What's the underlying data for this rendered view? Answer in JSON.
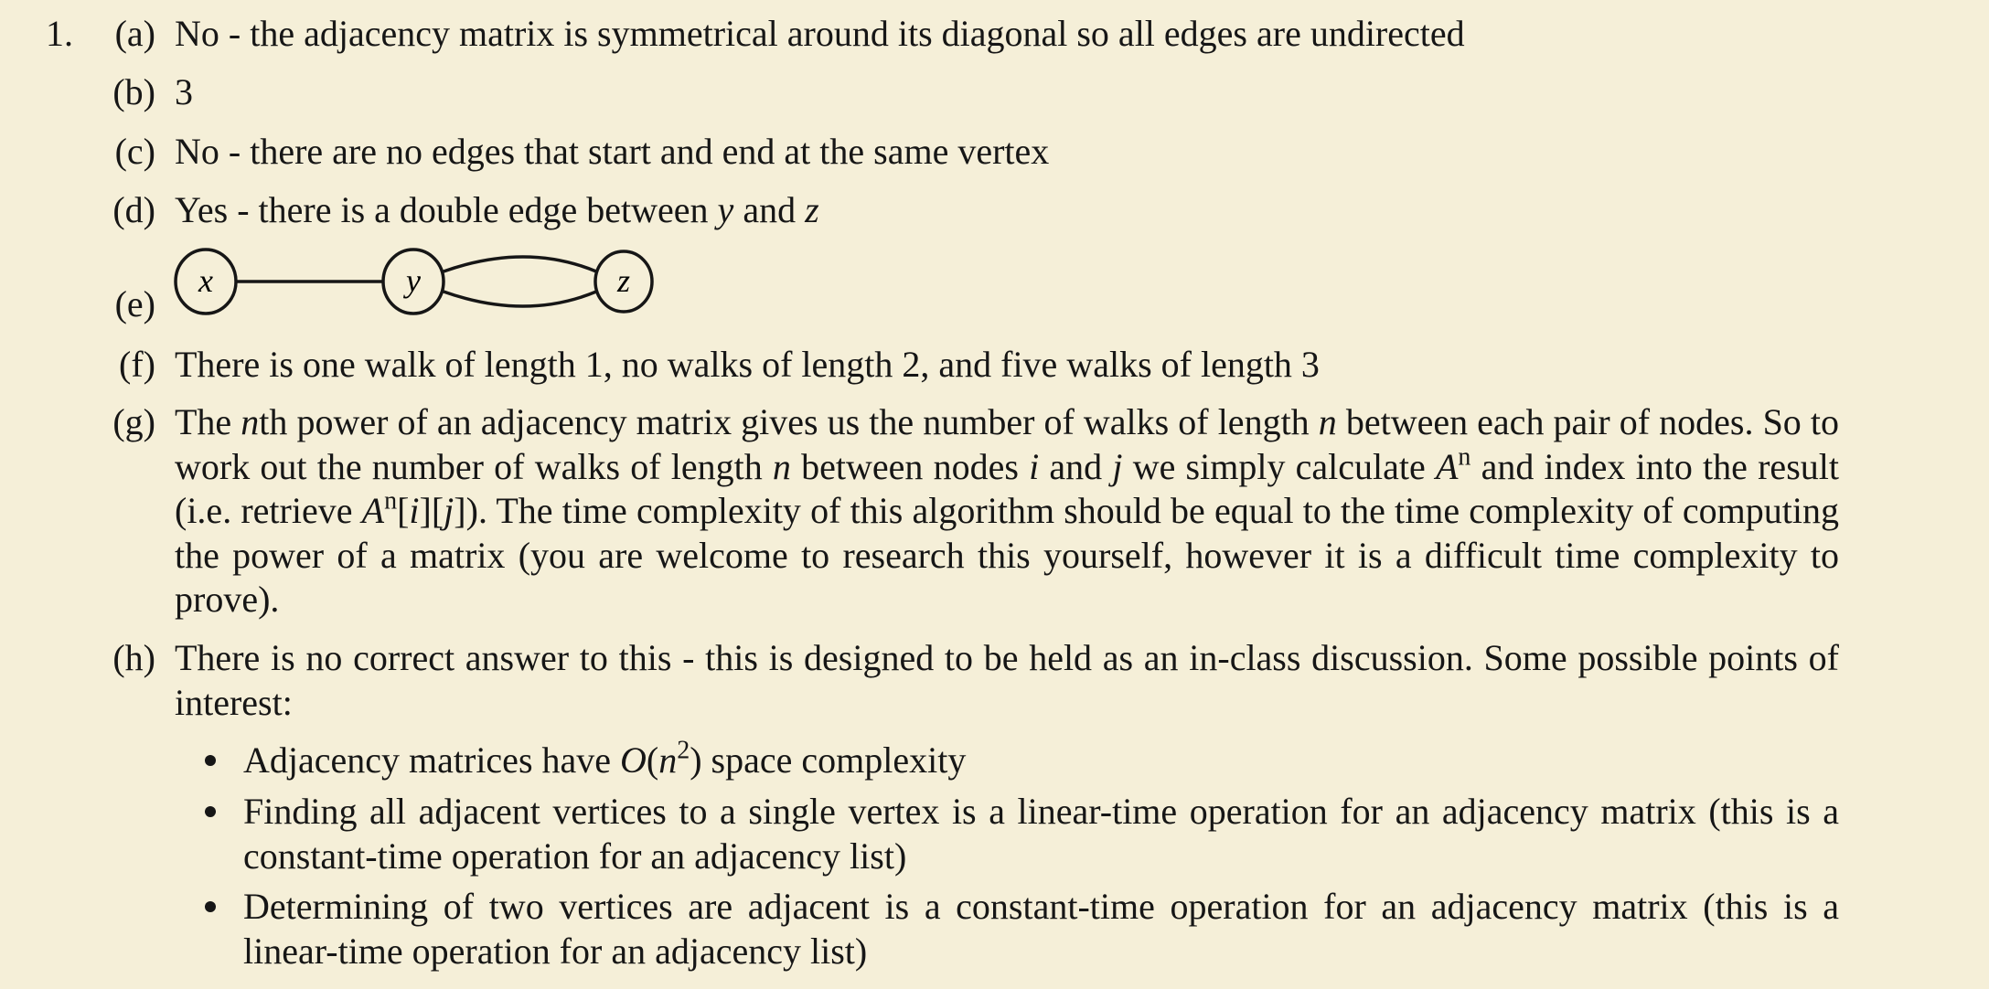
{
  "question_number": "1.",
  "items": [
    {
      "label": "(a)",
      "parts": [
        {
          "t": "No - the adjacency matrix is symmetrical around its diagonal so all edges are undirected"
        }
      ]
    },
    {
      "label": "(b)",
      "parts": [
        {
          "t": "3"
        }
      ]
    },
    {
      "label": "(c)",
      "parts": [
        {
          "t": "No - there are no edges that start and end at the same vertex"
        }
      ]
    },
    {
      "label": "(d)",
      "parts": [
        {
          "t": "Yes - there is a double edge between "
        },
        {
          "t": "y",
          "m": "i"
        },
        {
          "t": " and "
        },
        {
          "t": "z",
          "m": "i"
        }
      ]
    },
    {
      "label": "(e)",
      "graph": {
        "nodes": [
          "x",
          "y",
          "z"
        ],
        "edges": [
          [
            "x",
            "y"
          ],
          [
            "y",
            "z"
          ],
          [
            "y",
            "z"
          ]
        ]
      }
    },
    {
      "label": "(f)",
      "parts": [
        {
          "t": "There is one walk of length 1, no walks of length 2, and five walks of length 3"
        }
      ]
    },
    {
      "label": "(g)",
      "parts": [
        {
          "t": "The "
        },
        {
          "t": "n",
          "m": "i"
        },
        {
          "t": "th power of an adjacency matrix gives us the number of walks of length "
        },
        {
          "t": "n",
          "m": "i"
        },
        {
          "t": " between each pair of nodes.  So to work out the number of walks of length "
        },
        {
          "t": "n",
          "m": "i"
        },
        {
          "t": " between nodes "
        },
        {
          "t": "i",
          "m": "i"
        },
        {
          "t": " and "
        },
        {
          "t": "j",
          "m": "i"
        },
        {
          "t": " we simply calculate "
        },
        {
          "t": "A",
          "m": "i"
        },
        {
          "t": "n",
          "m": "sup"
        },
        {
          "t": " and index into the result (i.e. retrieve "
        },
        {
          "t": "A",
          "m": "i"
        },
        {
          "t": "n",
          "m": "sup"
        },
        {
          "t": "["
        },
        {
          "t": "i",
          "m": "i"
        },
        {
          "t": "]["
        },
        {
          "t": "j",
          "m": "i"
        },
        {
          "t": "]).  The time complexity of this algorithm should be equal to the time complexity of computing the power of a matrix (you are welcome to research this yourself, however it is a difficult time complexity to prove)."
        }
      ]
    },
    {
      "label": "(h)",
      "parts": [
        {
          "t": "There is no correct answer to this - this is designed to be held as an in-class discussion.  Some possible points of interest:"
        }
      ],
      "bullets": [
        [
          {
            "t": "Adjacency matrices have "
          },
          {
            "t": "O",
            "m": "i"
          },
          {
            "t": "("
          },
          {
            "t": "n",
            "m": "i"
          },
          {
            "t": "2",
            "m": "sup"
          },
          {
            "t": ") space complexity"
          }
        ],
        [
          {
            "t": "Finding all adjacent vertices to a single vertex is a linear-time operation for an adjacency matrix (this is a constant-time operation for an adjacency list)"
          }
        ],
        [
          {
            "t": "Determining of two vertices are adjacent is a constant-time operation for an adjacency matrix (this is a linear-time operation for an adjacency list)"
          }
        ]
      ]
    }
  ]
}
